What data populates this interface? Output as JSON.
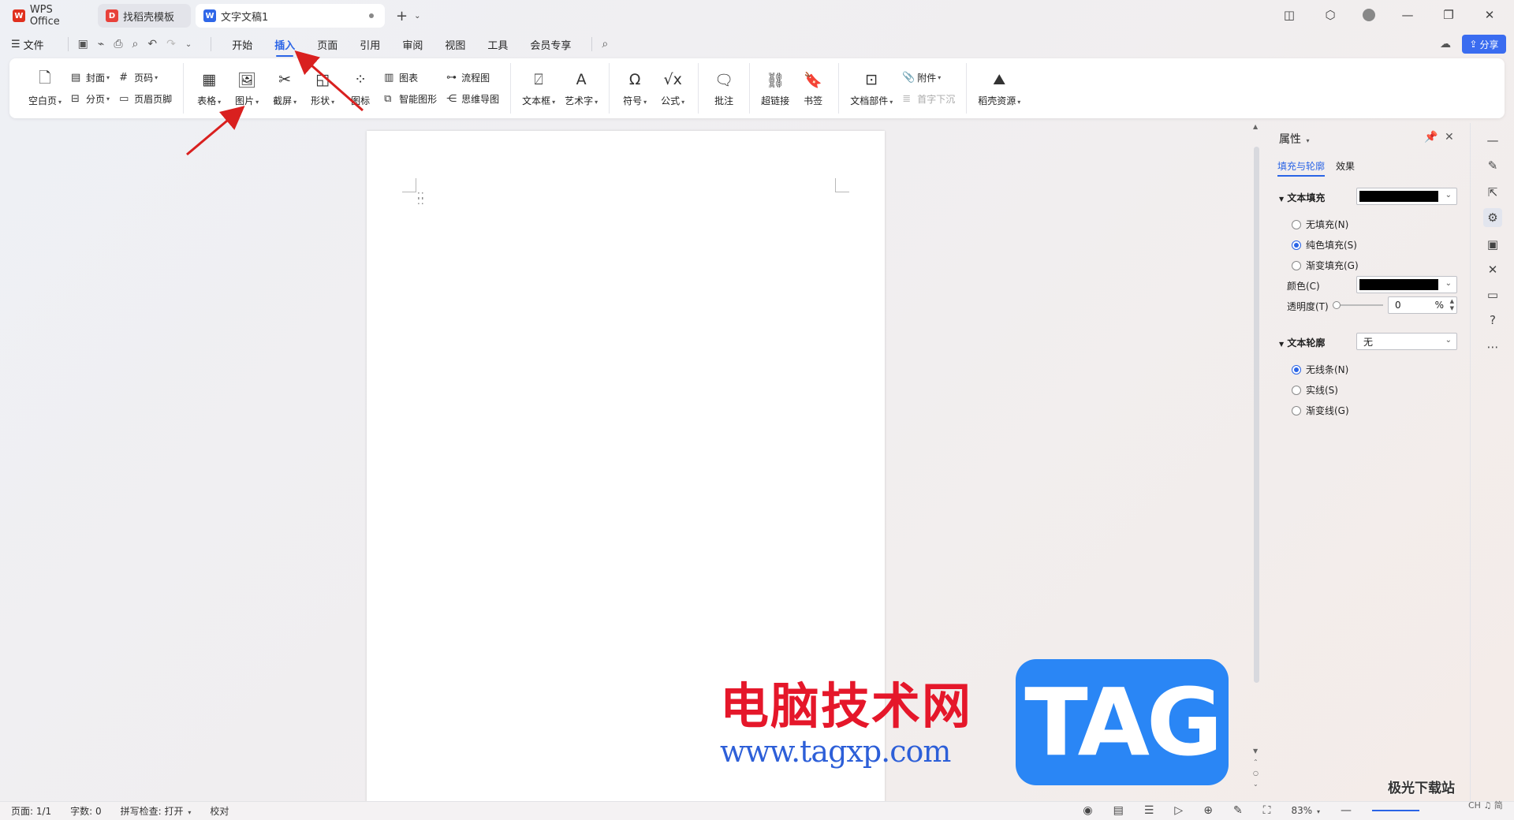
{
  "tabs": [
    {
      "label": "WPS Office",
      "icon": "wps-logo-icon"
    },
    {
      "label": "找稻壳模板",
      "icon": "docer-logo-icon"
    },
    {
      "label": "文字文稿1",
      "icon": "writer-logo-icon",
      "active": true
    }
  ],
  "menubar": {
    "file_label": "文件",
    "tabs": [
      "开始",
      "插入",
      "页面",
      "引用",
      "审阅",
      "视图",
      "工具",
      "会员专享"
    ],
    "active_tab": "插入",
    "share_label": "分享"
  },
  "ribbon": {
    "blank_page": "空白页",
    "cover": "封面",
    "page_break": "分页",
    "page_number": "页码",
    "header_footer": "页眉页脚",
    "table": "表格",
    "picture": "图片",
    "screenshot": "截屏",
    "shape": "形状",
    "icon": "图标",
    "chart": "图表",
    "smart_art": "智能图形",
    "flowchart": "流程图",
    "mind_map": "思维导图",
    "textbox": "文本框",
    "word_art": "艺术字",
    "symbol": "符号",
    "formula": "公式",
    "comment": "批注",
    "hyperlink": "超链接",
    "bookmark": "书签",
    "doc_parts": "文档部件",
    "attachment": "附件",
    "drop_cap": "首字下沉",
    "docer_resources": "稻壳资源"
  },
  "props": {
    "title": "属性",
    "tab_fill": "填充与轮廓",
    "tab_effect": "效果",
    "text_fill_label": "文本填充",
    "no_fill": "无填充(N)",
    "solid_fill": "纯色填充(S)",
    "gradient_fill": "渐变填充(G)",
    "color_label": "颜色(C)",
    "transparency_label": "透明度(T)",
    "transparency_value": "0",
    "transparency_unit": "%",
    "text_outline_label": "文本轮廓",
    "outline_value": "无",
    "no_line": "无线条(N)",
    "solid_line": "实线(S)",
    "gradient_line": "渐变线(G)",
    "fill_color": "#000000"
  },
  "status": {
    "page": "页面: 1/1",
    "words": "字数: 0",
    "spell_check": "拼写检查: 打开",
    "proofread": "校对",
    "zoom": "83%"
  },
  "watermark": {
    "cn_title": "电脑技术网",
    "url": "www.tagxp.com",
    "tag": "TAG",
    "xz_title": "极光下载站",
    "xz_sub": "CH ♫ 简"
  },
  "colors": {
    "accent": "#2a64e6",
    "share_bg": "#3a6cf0",
    "annotation_arrow": "#d9201f"
  }
}
